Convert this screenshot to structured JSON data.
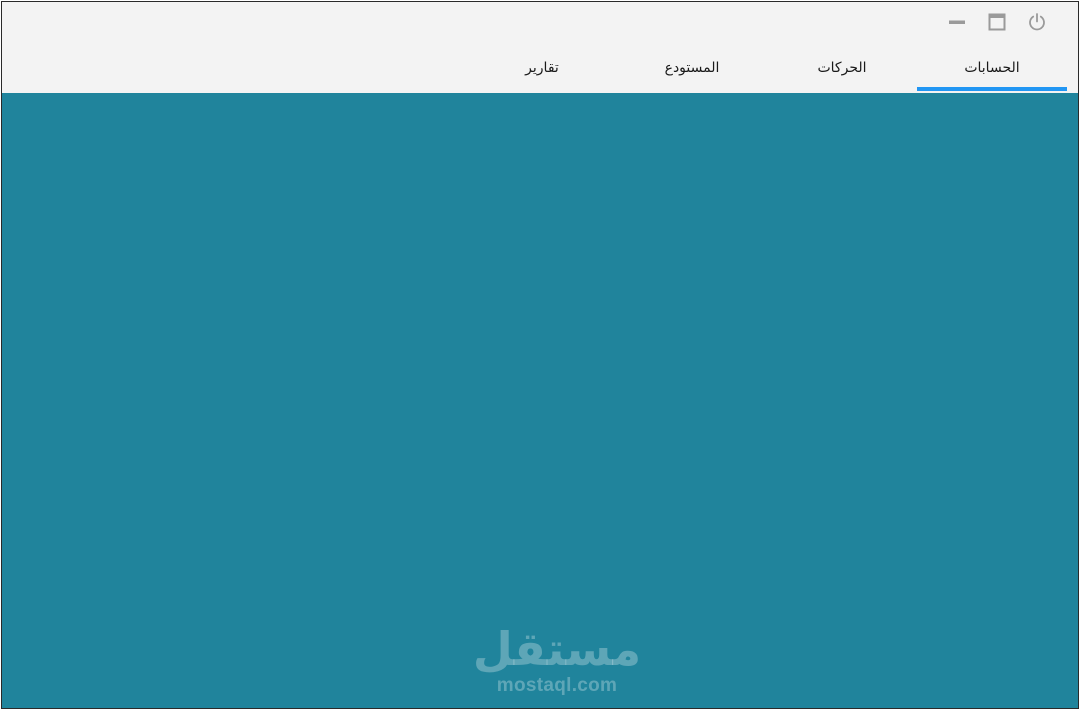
{
  "window_controls": {
    "icons": [
      "minimize-icon",
      "maximize-icon",
      "power-icon"
    ]
  },
  "tabs": [
    {
      "label": "الحسابات",
      "selected": true
    },
    {
      "label": "الحركات",
      "selected": false
    },
    {
      "label": "المستودع",
      "selected": false
    },
    {
      "label": "تقارير",
      "selected": false
    }
  ],
  "colors": {
    "window_background": "#f3f3f3",
    "content_background": "#20849c",
    "tab_indicator": "#2196f3"
  },
  "watermark": {
    "arabic": "مستقل",
    "latin": "mostaql.com"
  }
}
